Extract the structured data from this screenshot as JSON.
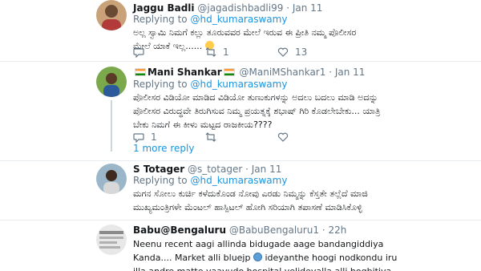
{
  "tweets": [
    {
      "name": "Jaggu Badli",
      "handle": "@jagadishbadli99",
      "time": "Jan 11",
      "replying_label": "Replying to",
      "replying_to": "@hd_kumaraswamy",
      "text": "ಅಲ್ಲ ಸ್ವಾಮಿ ನಿಮಗೆ ಕಲ್ಲು ತೂರುವವರ ಮೇಲೆ ಇರುವ ಈ ಪ್ರೀತಿ ನಮ್ಮ ಪೊಲೀಸರ ಮೇಲೆ ಯಾಕೆ ಇಲ್ಲ......",
      "retweets": "1",
      "likes": "13"
    },
    {
      "name": "Mani Shankar",
      "handle": "@ManiMShankar1",
      "time": "Jan 11",
      "replying_label": "Replying to",
      "replying_to": "@hd_kumaraswamy",
      "text": "ಪೊಲೀಸರ ವಿಡಿಯೋ ಮಾಡಿದ ವಿಡಿಯೋ ತುಣುಕುಗಳನ್ನು ಅದಲು ಬದಲು ಮಾಡಿ ಅದನ್ನು ಪೊಲೀಸರ ವಿರುದ್ಧವೇ ತಿರುಗಿಸುವ ನಿಮ್ಮ ಪ್ರಯತ್ನಕ್ಕೆ ಶಭಾಷ್ ಗಿರಿ ಕೊಡಲೇಬೇಕು... ಯಾತ್ರಿ ಬೇಕು ನಿಮಗೆ ಈ ಕೀಳು ಮಟ್ಟದ ರಾಜಕೀಯ????",
      "replies": "1",
      "more_replies": "1 more reply"
    },
    {
      "name": "S Totager",
      "handle": "@s_totager",
      "time": "Jan 11",
      "replying_label": "Replying to",
      "replying_to": "@hd_kumaraswamy",
      "text": "ಮಗನ ಸೋಲು ಕುರ್ಚಿ ಕಳೆದುಕೊಂಡ ನೋವು ಎರಡು ನಿಮ್ಮನ್ನು ಕೆಸ್ತತೇ ತಲ್ಲೆದೆ ಮಾಜಿ ಮುಖ್ಯಮಂತ್ರಿಗಳೇ ಮೆಂಟಲ್ ಹಾಸ್ಪಿಟಲ್ ಹೋಗಿ ಸರಿಯಾಗಿ ತಪಾಸಣೆ ಮಾಡಿಸಿಕೊಳ್ಳಿ"
    },
    {
      "name": "Babu@Bengaluru",
      "handle": "@BabuBengaluru1",
      "time": "22h",
      "text_part1": "Neenu recent aagi allinda bidugade aage bandangiddiya Kanda.... Market alli bluejp ",
      "text_part2": " ideyanthe hoogi nodkondu iru illa andre matte yaavudo hospital yelideyalla alli hogbitiya"
    }
  ],
  "colors": {
    "link": "#1b95e0",
    "secondary_text": "#657786",
    "divider": "#e6ecf0"
  },
  "icons": [
    "reply-icon",
    "retweet-icon",
    "like-icon",
    "flag-india-icon",
    "emoji-icon",
    "globe-icon"
  ]
}
